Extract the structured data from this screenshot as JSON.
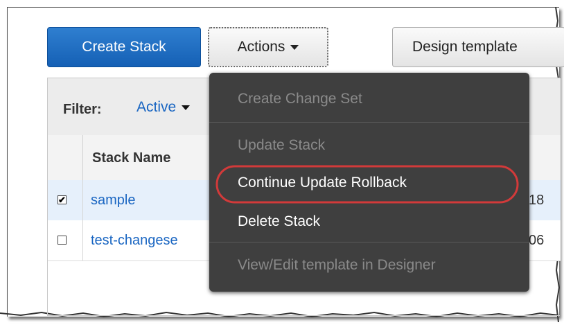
{
  "toolbar": {
    "create_stack_label": "Create Stack",
    "actions_label": "Actions",
    "design_template_label": "Design template"
  },
  "filter": {
    "label": "Filter:",
    "value": "Active"
  },
  "table": {
    "columns": [
      "Stack Name"
    ],
    "rows": [
      {
        "name": "sample",
        "checked": true,
        "checkbox_glyph": "✔",
        "tail": "18"
      },
      {
        "name": "test-changese",
        "checked": false,
        "checkbox_glyph": "",
        "tail": "06"
      }
    ]
  },
  "actions_menu": {
    "items": [
      {
        "label": "Create Change Set",
        "enabled": false
      },
      {
        "label": "Update Stack",
        "enabled": false
      },
      {
        "label": "Continue Update Rollback",
        "enabled": true,
        "highlighted": true
      },
      {
        "label": "Delete Stack",
        "enabled": true
      },
      {
        "label": "View/Edit template in Designer",
        "enabled": false
      }
    ]
  },
  "colors": {
    "primary_button": "#1a6ec0",
    "link": "#1a66c2",
    "menu_background": "#3f3f3f",
    "highlight_ring": "#d23a3a",
    "selected_row": "#e6f0fb"
  },
  "icons": {
    "caret": "chevron-down-icon",
    "checkbox": "checkbox-icon"
  }
}
